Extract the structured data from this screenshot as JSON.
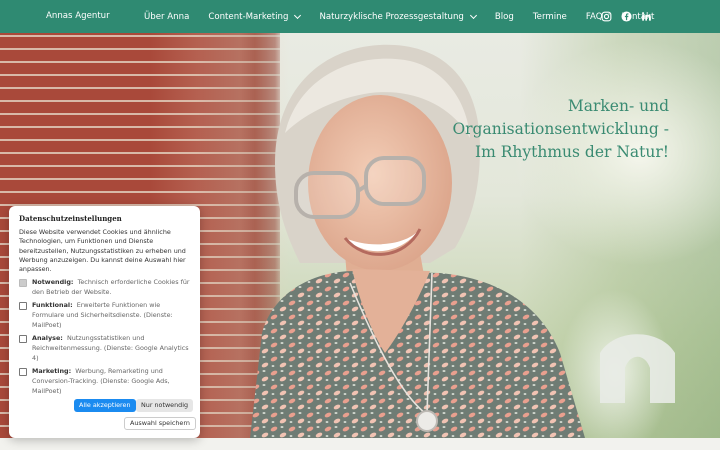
{
  "nav": {
    "brand": "Annas Agentur",
    "items": [
      {
        "label": "Über Anna",
        "dropdown": false
      },
      {
        "label": "Content-Marketing",
        "dropdown": true
      },
      {
        "label": "Naturzyklische Prozessgestaltung",
        "dropdown": true
      },
      {
        "label": "Blog",
        "dropdown": false
      },
      {
        "label": "Termine",
        "dropdown": false
      },
      {
        "label": "FAQ",
        "dropdown": false
      },
      {
        "label": "Kontakt",
        "dropdown": false
      }
    ],
    "social": [
      "instagram-icon",
      "facebook-icon",
      "linkedin-icon"
    ],
    "bg_color": "#2f8a72"
  },
  "hero": {
    "headline": [
      "Marken- und",
      "Organisationsentwicklung -",
      "Im Rhythmus der Natur!"
    ],
    "headline_color": "#3a8b72"
  },
  "cookie": {
    "title": "Datenschutzeinstellungen",
    "intro": "Diese Website verwendet Cookies und ähnliche Technologien, um Funktionen und Dienste bereitzustellen, Nutzungsstatistiken zu erheben und Werbung anzuzeigen. Du kannst deine Auswahl hier anpassen.",
    "options": [
      {
        "label": "Notwendig:",
        "desc": "Technisch erforderliche Cookies für den Betrieb der Website.",
        "checked": true,
        "disabled": true
      },
      {
        "label": "Funktional:",
        "desc": "Erweiterte Funktionen wie Formulare und Sicherheitsdienste. (Dienste: MailPoet)",
        "checked": false,
        "disabled": false
      },
      {
        "label": "Analyse:",
        "desc": "Nutzungsstatistiken und Reichweitenmessung. (Dienste: Google Analytics 4)",
        "checked": false,
        "disabled": false
      },
      {
        "label": "Marketing:",
        "desc": "Werbung, Remarketing und Conversion-Tracking. (Dienste: Google Ads, MailPoet)",
        "checked": false,
        "disabled": false
      }
    ],
    "accept_all": "Alle akzeptieren",
    "only_necessary": "Nur notwendig",
    "save_selection": "Auswahl speichern",
    "accent": "#1b8bf0"
  }
}
